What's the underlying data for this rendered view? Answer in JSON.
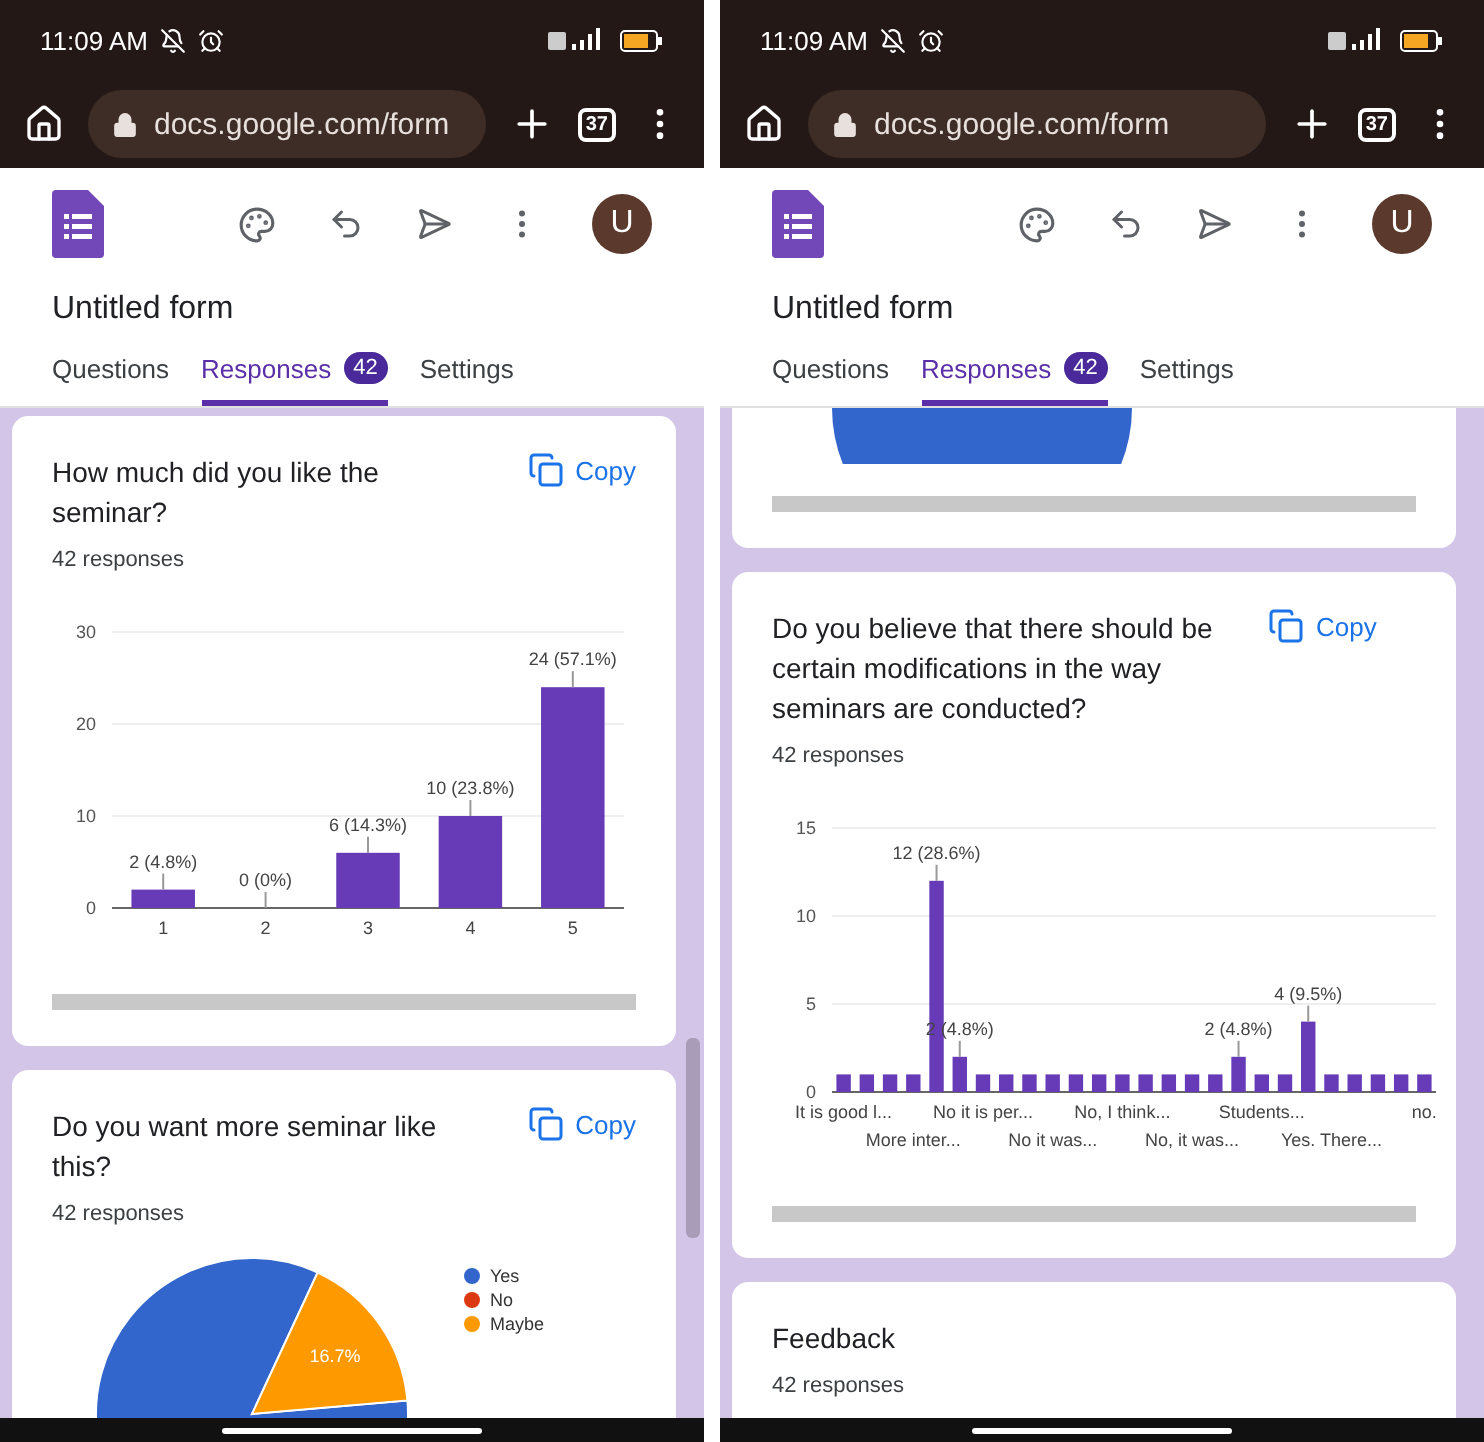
{
  "phones": [
    {
      "status_bar": {
        "time": "11:09 AM"
      },
      "browser": {
        "url": "docs.google.com/form",
        "tab_count": "37"
      },
      "form": {
        "title": "Untitled form",
        "avatar": "U"
      },
      "tabs": [
        {
          "label": "Questions",
          "selected": false
        },
        {
          "label": "Responses",
          "selected": true,
          "badge": "42"
        },
        {
          "label": "Settings",
          "selected": false
        }
      ],
      "cards": [
        {
          "kind": "chart",
          "question": "How much did you like the seminar?",
          "action": "Copy",
          "responses": "42 responses",
          "chart_data": {
            "type": "bar",
            "categories": [
              "1",
              "2",
              "3",
              "4",
              "5"
            ],
            "series": [
              {
                "color": "#673ab7",
                "values": [
                  2,
                  0,
                  6,
                  10,
                  24
                ]
              }
            ],
            "ylim": [
              0,
              30
            ],
            "yticks": [
              0,
              10,
              20,
              30
            ],
            "value_labels": [
              "2 (4.8%)",
              "0 (0%)",
              "6 (14.3%)",
              "10 (23.8%)",
              "24 (57.1%)"
            ]
          }
        },
        {
          "kind": "chart",
          "question": "Do you want more seminar like this?",
          "action": "Copy",
          "responses": "42 responses",
          "legend": [
            {
              "color": "#3366cc"
            },
            {
              "color": "#dc3912"
            },
            {
              "color": "#ff9900"
            }
          ],
          "chart_data": {
            "type": "pie",
            "categories": [
              "Yes",
              "No",
              "Maybe"
            ],
            "values": [
              83.3,
              0,
              16.7
            ],
            "value_labels": [
              null,
              null,
              "16.7%"
            ]
          }
        }
      ]
    },
    {
      "status_bar": {
        "time": "11:09 AM"
      },
      "browser": {
        "url": "docs.google.com/form",
        "tab_count": "37"
      },
      "form": {
        "title": "Untitled form",
        "avatar": "U"
      },
      "tabs": [
        {
          "label": "Questions",
          "selected": false
        },
        {
          "label": "Responses",
          "selected": true,
          "badge": "42"
        },
        {
          "label": "Settings",
          "selected": false
        }
      ],
      "cards": [
        {
          "kind": "chart_tail"
        },
        {
          "kind": "chart",
          "question": "Do you believe that there should be certain modifications in the way seminars are conducted?",
          "action": "Copy",
          "responses": "42 responses",
          "chart_data": {
            "type": "bar",
            "categories": [
              "It is good l...",
              null,
              null,
              "More inter...",
              null,
              null,
              "No it is per...",
              null,
              null,
              "No it was...",
              null,
              null,
              "No, I think...",
              null,
              null,
              "No, it was...",
              null,
              null,
              "Students...",
              null,
              null,
              "Yes. There...",
              null,
              null,
              null,
              "no."
            ],
            "series": [
              {
                "color": "#673ab7",
                "values": [
                  1,
                  1,
                  1,
                  1,
                  12,
                  2,
                  1,
                  1,
                  1,
                  1,
                  1,
                  1,
                  1,
                  1,
                  1,
                  1,
                  1,
                  2,
                  1,
                  1,
                  4,
                  1,
                  1,
                  1,
                  1,
                  1
                ]
              }
            ],
            "ylim": [
              0,
              15
            ],
            "yticks": [
              0,
              5,
              10,
              15
            ],
            "value_labels": [
              null,
              null,
              null,
              null,
              "12 (28.6%)",
              "2 (4.8%)",
              null,
              null,
              null,
              null,
              null,
              null,
              null,
              null,
              null,
              null,
              null,
              "2 (4.8%)",
              null,
              null,
              "4 (9.5%)",
              null,
              null,
              null,
              null,
              null
            ]
          }
        },
        {
          "kind": "text",
          "question": "Feedback",
          "responses": "42 responses"
        }
      ]
    }
  ]
}
